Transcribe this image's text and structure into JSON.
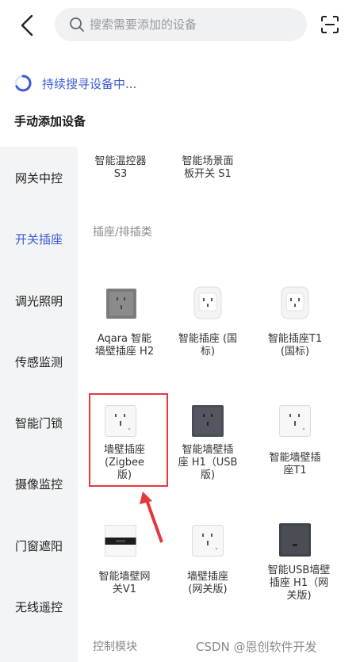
{
  "search": {
    "placeholder": "搜索需要添加的设备"
  },
  "status": {
    "searching": "持续搜寻设备中..."
  },
  "manual": {
    "title": "手动添加设备"
  },
  "sidebar": {
    "items": [
      {
        "label": "网关中控"
      },
      {
        "label": "开关插座"
      },
      {
        "label": "调光照明"
      },
      {
        "label": "传感监测"
      },
      {
        "label": "智能门锁"
      },
      {
        "label": "摄像监控"
      },
      {
        "label": "门窗遮阳"
      },
      {
        "label": "无线遥控"
      }
    ],
    "active_index": 1
  },
  "content": {
    "top_devices": [
      {
        "name": "智能温控器\nS3"
      },
      {
        "name": "智能场景面\n板开关 S1"
      }
    ],
    "section1": "插座/排插类",
    "devices": [
      {
        "name": "Aqara 智能\n墙壁插座 H2",
        "icon": "gray-socket"
      },
      {
        "name": "智能插座 (国\n标)",
        "icon": "white-plug"
      },
      {
        "name": "智能插座T1\n(国标)",
        "icon": "white-plug"
      },
      {
        "name": "墙壁插座\n(Zigbee\n版)",
        "icon": "white-wall-socket"
      },
      {
        "name": "智能墙壁插\n座 H1（USB\n版)",
        "icon": "dark-wall-socket"
      },
      {
        "name": "智能墙壁插\n座T1",
        "icon": "white-wall-socket"
      },
      {
        "name": "智能墙壁网\n关V1",
        "icon": "gateway-panel"
      },
      {
        "name": "墙壁插座\n(网关版)",
        "icon": "white-wall-socket"
      },
      {
        "name": "智能USB墙壁\n插座 H1（网\n关版)",
        "icon": "dark-usb-socket"
      }
    ],
    "section2": "控制模块"
  },
  "watermark": "CSDN @恩创软件开发",
  "colors": {
    "accent": "#3b5bd6",
    "highlight": "#e5383b"
  }
}
